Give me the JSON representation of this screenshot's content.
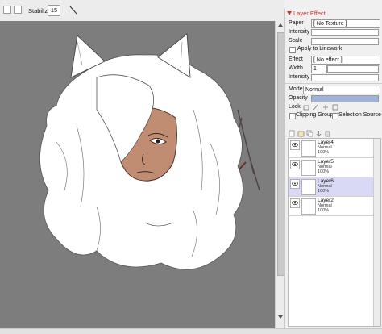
{
  "toolbar": {
    "stabilizer_label": "Stabilizer",
    "stabilizer_value": "15"
  },
  "canvas": {
    "background_color": "#7d7d7d",
    "content": "illustration"
  },
  "layer_effect": {
    "title": "Layer Effect",
    "paper_label": "Paper",
    "paper_value": "[ No Texture ]",
    "intensity_label": "Intensity",
    "scale_label": "Scale",
    "apply_to_linework_label": "Apply to Linework",
    "effect_label": "Effect",
    "effect_value": "[ No effect ]",
    "width_label": "Width",
    "width_value": "1",
    "intensity2_label": "Intensity"
  },
  "layer_props": {
    "mode_label": "Mode",
    "mode_value": "Normal",
    "opacity_label": "Opacity",
    "lock_label": "Lock",
    "clipping_group_label": "Clipping Group",
    "selection_source_label": "Selection Source"
  },
  "layers": [
    {
      "name": "Layer4",
      "mode": "Normal",
      "opacity": "100%",
      "visible": true,
      "selected": false
    },
    {
      "name": "Layer5",
      "mode": "Normal",
      "opacity": "100%",
      "visible": true,
      "selected": false
    },
    {
      "name": "Layer6",
      "mode": "Normal",
      "opacity": "100%",
      "visible": true,
      "selected": true
    },
    {
      "name": "Layer2",
      "mode": "Normal",
      "opacity": "100%",
      "visible": true,
      "selected": false
    }
  ],
  "colors": {
    "accent": "#c0392b",
    "selected_layer": "#d9d9f6",
    "skin": "#c08d73",
    "hair": "#ffffff"
  }
}
